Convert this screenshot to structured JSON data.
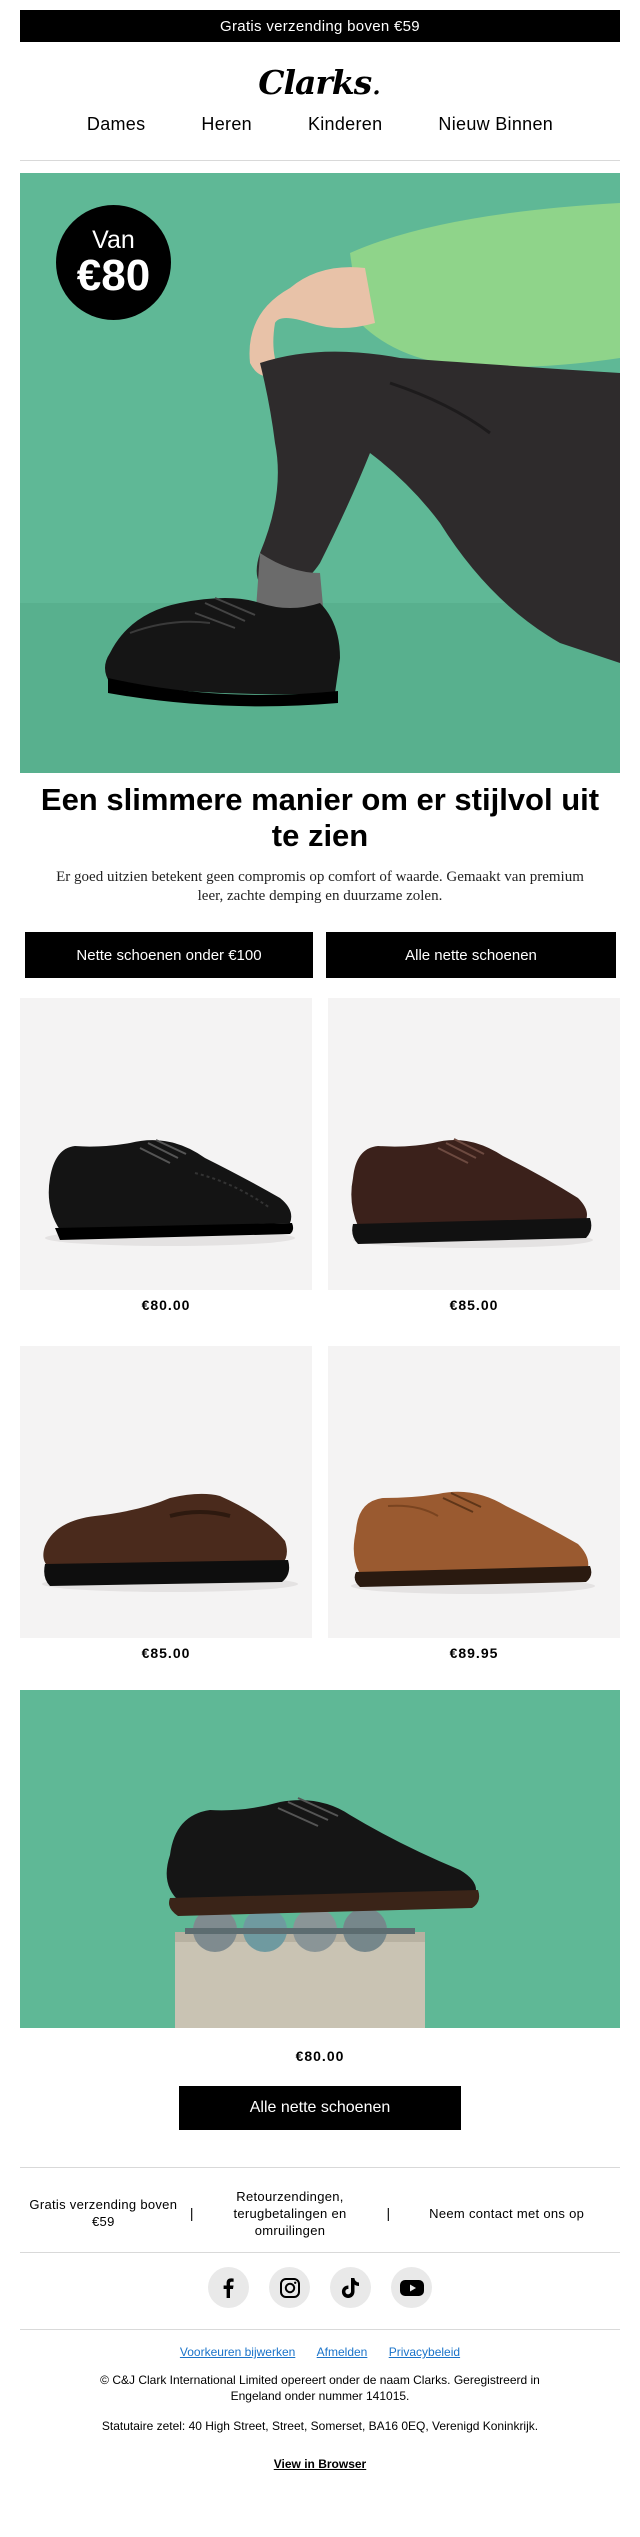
{
  "promo": "Gratis verzending boven €59",
  "brand": {
    "name": "Clarks",
    "dot": "."
  },
  "nav": [
    "Dames",
    "Heren",
    "Kinderen",
    "Nieuw Binnen"
  ],
  "hero": {
    "badge_line1": "Van",
    "badge_line2": "€80",
    "bg_color": "#5fb896"
  },
  "headline": "Een slimmere manier om er stijlvol uit te zien",
  "subcopy": "Er goed uitzien betekent geen compromis op comfort of waarde. Gemaakt van premium leer, zachte demping en duurzame zolen.",
  "cta_buttons": [
    "Nette schoenen onder €100",
    "Alle nette schoenen"
  ],
  "products": [
    {
      "price": "€80.00",
      "color": "black",
      "style": "brogue"
    },
    {
      "price": "€85.00",
      "color": "dark-brown",
      "style": "derby"
    },
    {
      "price": "€85.00",
      "color": "brown-suede",
      "style": "loafer"
    },
    {
      "price": "€89.95",
      "color": "tan",
      "style": "derby"
    }
  ],
  "feature": {
    "price": "€80.00",
    "cta": "Alle nette schoenen"
  },
  "usps": [
    "Gratis verzending boven €59",
    "Retourzendingen, terugbetalingen en omruilingen",
    "Neem contact met ons op"
  ],
  "usp_separator": "|",
  "social": [
    "facebook-icon",
    "instagram-icon",
    "tiktok-icon",
    "youtube-icon"
  ],
  "footer": {
    "links": [
      "Voorkeuren bijwerken",
      "Afmelden",
      "Privacybeleid"
    ],
    "legal1": "© C&J Clark International Limited opereert onder de naam Clarks. Geregistreerd in Engeland onder nummer 141015.",
    "legal2": "Statutaire zetel: 40 High Street, Street, Somerset, BA16 0EQ, Verenigd Koninkrijk.",
    "view_in_browser": "View in Browser"
  }
}
